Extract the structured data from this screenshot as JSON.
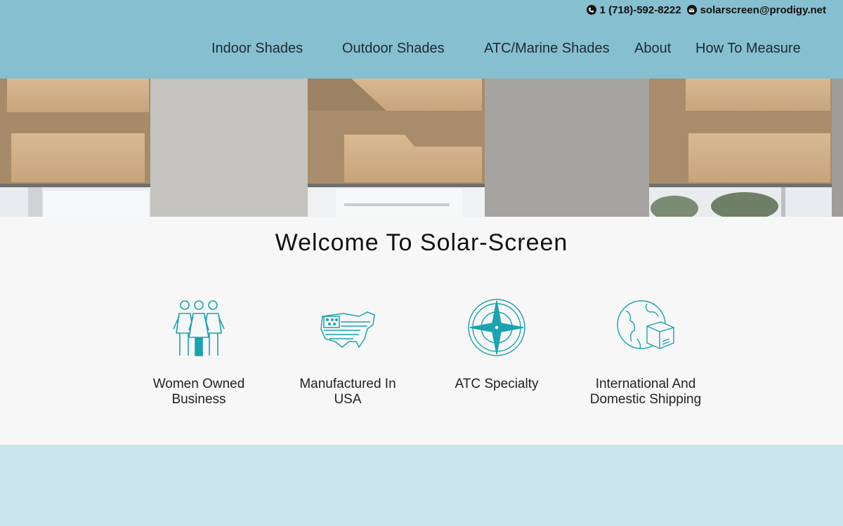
{
  "header": {
    "contact": {
      "phone": "1 (718)-592-8222",
      "phone_icon": "phone-icon",
      "email": "solarscreen@prodigy.net",
      "email_icon": "envelope-icon"
    },
    "nav": [
      {
        "label": "Indoor Shades"
      },
      {
        "label": "Outdoor Shades"
      },
      {
        "label": "ATC/Marine Shades"
      },
      {
        "label": "About"
      },
      {
        "label": "How To Measure"
      }
    ]
  },
  "hero": {
    "image": "roller-shades-photo"
  },
  "welcome": {
    "title": "Welcome To Solar-Screen",
    "features": [
      {
        "icon": "women-group-icon",
        "label": "Women Owned Business"
      },
      {
        "icon": "usa-map-icon",
        "label": "Manufactured In USA"
      },
      {
        "icon": "compass-star-icon",
        "label": "ATC Specialty"
      },
      {
        "icon": "globe-box-icon",
        "label": "International And Domestic Shipping"
      }
    ]
  },
  "colors": {
    "header_bg": "#86bfd0",
    "footer_bg": "#cbe6ef",
    "icon_teal": "#1aa3b0",
    "section_bg": "#f7f7f7"
  }
}
